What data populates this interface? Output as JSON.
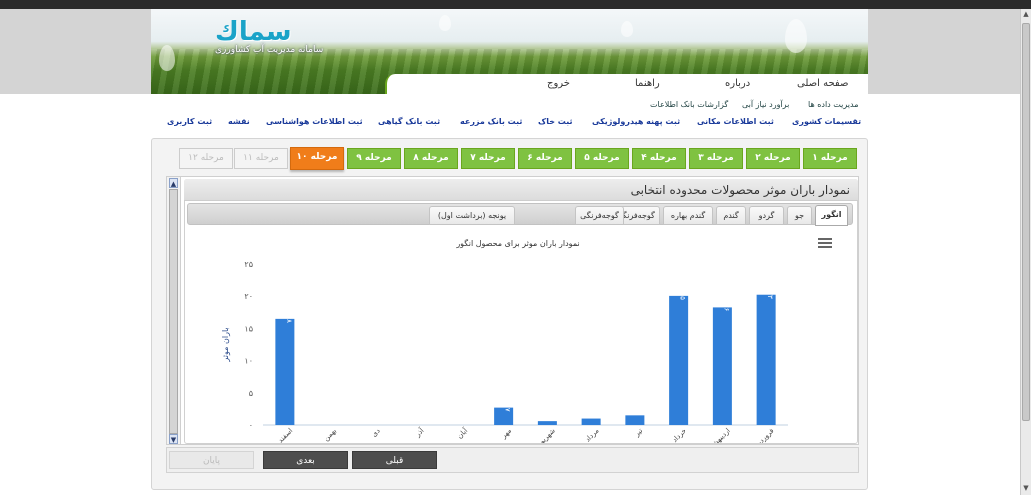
{
  "header": {
    "logo_text": "سماك",
    "logo_sub": "سامانه مدیریت آب کشاورزی"
  },
  "nav": {
    "items": [
      {
        "label": "صفحه اصلی"
      },
      {
        "label": "درباره"
      },
      {
        "label": "راهنما"
      },
      {
        "label": "خروج"
      }
    ]
  },
  "subnav_top": [
    {
      "label": "مدیریت داده ها"
    },
    {
      "label": "برآورد نیاز آبی"
    },
    {
      "label": "گزارشات بانک اطلاعات"
    }
  ],
  "subnav_bottom": [
    {
      "label": "تقسیمات کشوری"
    },
    {
      "label": "ثبت اطلاعات مکانی"
    },
    {
      "label": "ثبت پهنه هیدرولوژیکی"
    },
    {
      "label": "ثبت خاک"
    },
    {
      "label": "ثبت بانک مزرعه"
    },
    {
      "label": "ثبت بانک گیاهی"
    },
    {
      "label": "ثبت اطلاعات هواشناسی"
    },
    {
      "label": "نقشه"
    },
    {
      "label": "ثبت کاربری"
    }
  ],
  "steps": [
    {
      "label": "مرحله ۱",
      "state": "done"
    },
    {
      "label": "مرحله ۲",
      "state": "done"
    },
    {
      "label": "مرحله ۳",
      "state": "done"
    },
    {
      "label": "مرحله ۴",
      "state": "done"
    },
    {
      "label": "مرحله ۵",
      "state": "done"
    },
    {
      "label": "مرحله ۶",
      "state": "done"
    },
    {
      "label": "مرحله ۷",
      "state": "done"
    },
    {
      "label": "مرحله ۸",
      "state": "done"
    },
    {
      "label": "مرحله ۹",
      "state": "done"
    },
    {
      "label": "مرحله ۱۰",
      "state": "active"
    },
    {
      "label": "مرحله ۱۱",
      "state": "disabled"
    },
    {
      "label": "مرحله ۱۲",
      "state": "disabled"
    }
  ],
  "panel": {
    "title": "نمودار باران موثر محصولات محدوده انتخابی"
  },
  "tabs": [
    {
      "label": "انگور",
      "active": true
    },
    {
      "label": "جو",
      "active": false
    },
    {
      "label": "گردو",
      "active": false
    },
    {
      "label": "گندم دیم",
      "active": false
    },
    {
      "label": "گندم بهاره",
      "active": false
    },
    {
      "label": "گوجه‌فرنگی",
      "active": false
    },
    {
      "label": "گوجه‌فرنگی",
      "active": false
    },
    {
      "label": "یونجه (برداشت اول)",
      "active": false
    }
  ],
  "chart_data": {
    "type": "bar",
    "title": "نمودار باران موثر برای محصول انگور",
    "ylabel": "باران موثر",
    "xlabel": "",
    "ylim": [
      0,
      25
    ],
    "yticks": [
      "۰",
      "۵",
      "۱۰",
      "۱۵",
      "۲۰",
      "۲۵"
    ],
    "categories": [
      "فروردین",
      "اردیبهشت",
      "خرداد",
      "تیر",
      "مرداد",
      "شهریور",
      "مهر",
      "آبان",
      "آذر",
      "دی",
      "بهمن",
      "اسفند"
    ],
    "values": [
      20.23,
      18.26,
      20.05,
      1.5,
      1.0,
      0.6,
      2.7,
      0,
      0,
      0,
      0,
      16.48
    ],
    "data_labels": [
      "۲۰.۲۳",
      "۱۸.۲۶",
      "۲۰.۰۵",
      "",
      "",
      "",
      "۲.۷",
      "",
      "",
      "",
      "",
      "۱۶.۴۸"
    ],
    "bar_color": "#2f7ed8",
    "grid": false,
    "legend": "none"
  },
  "footer": {
    "finish_label": "پایان",
    "next_label": "بعدی",
    "prev_label": "قبلی"
  },
  "colors": {
    "step_done": "#7fc241",
    "step_active": "#f07d1a",
    "bar": "#2f7ed8"
  }
}
